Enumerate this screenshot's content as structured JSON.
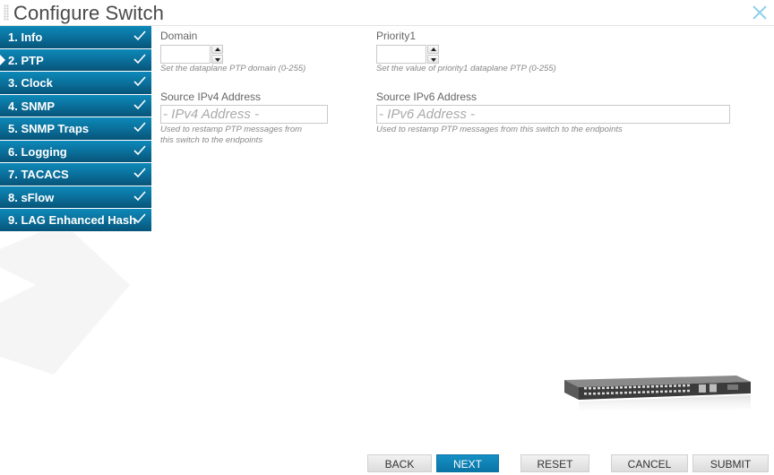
{
  "window": {
    "title": "Configure Switch"
  },
  "steps": [
    {
      "label": "1. Info",
      "done": true
    },
    {
      "label": "2. PTP",
      "done": true
    },
    {
      "label": "3. Clock",
      "done": true
    },
    {
      "label": "4. SNMP",
      "done": true
    },
    {
      "label": "5. SNMP Traps",
      "done": true
    },
    {
      "label": "6. Logging",
      "done": true
    },
    {
      "label": "7. TACACS",
      "done": true
    },
    {
      "label": "8. sFlow",
      "done": true
    },
    {
      "label": "9. LAG Enhanced Hash",
      "done": true
    }
  ],
  "active_step": "2. PTP",
  "form": {
    "domain": {
      "label": "Domain",
      "value": "",
      "hint": "Set the dataplane PTP domain (0-255)"
    },
    "priority1": {
      "label": "Priority1",
      "value": "",
      "hint": "Set the value of priority1 dataplane PTP (0-255)"
    },
    "ipv4": {
      "label": "Source IPv4 Address",
      "placeholder": "- IPv4 Address -",
      "value": "",
      "hint_line1": "Used to restamp PTP messages from",
      "hint_line2": "this switch to the endpoints"
    },
    "ipv6": {
      "label": "Source IPv6 Address",
      "placeholder": "- IPv6 Address -",
      "value": "",
      "hint": "Used to restamp PTP messages from this switch to the endpoints"
    }
  },
  "buttons": {
    "back": "BACK",
    "next": "NEXT",
    "reset": "RESET",
    "cancel": "CANCEL",
    "submit": "SUBMIT"
  },
  "colors": {
    "accent": "#0a74a6",
    "sidebar_top": "#0d89b9",
    "sidebar_bottom": "#075478"
  }
}
